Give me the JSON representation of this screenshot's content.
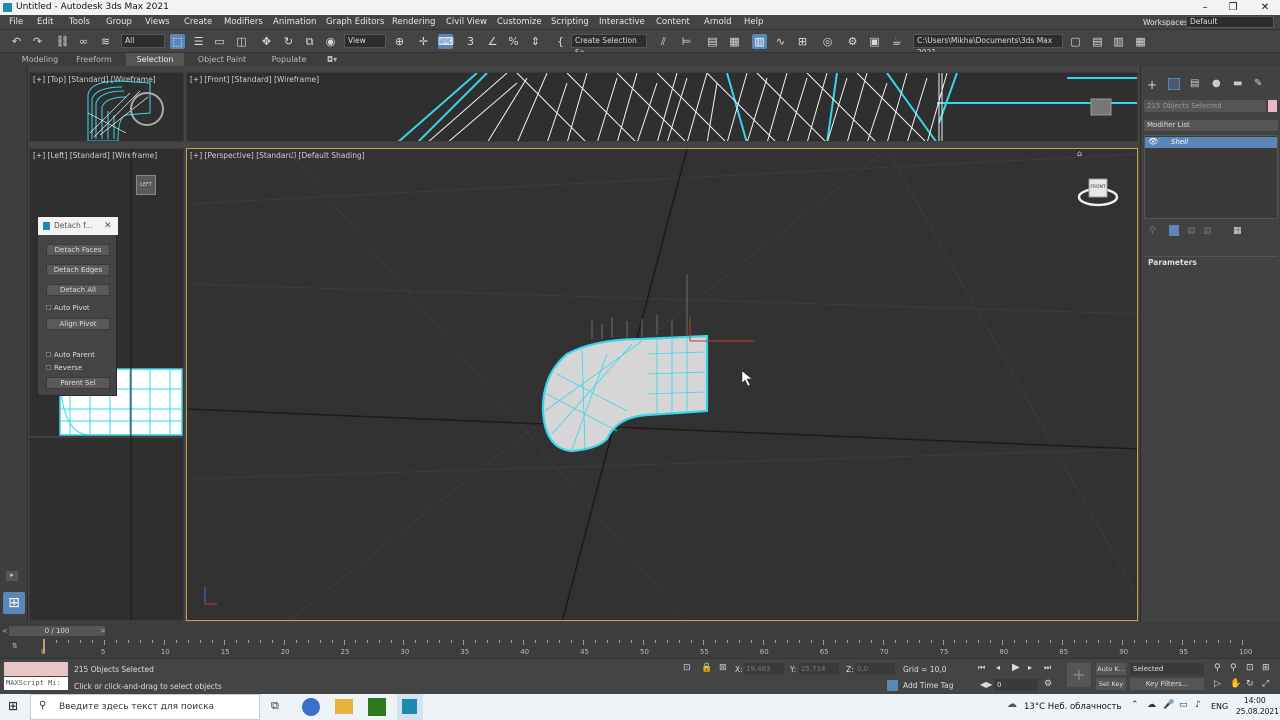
{
  "window": {
    "title": "Untitled - Autodesk 3ds Max 2021",
    "controls": [
      "–",
      "❐",
      "✕"
    ]
  },
  "menu": [
    "File",
    "Edit",
    "Tools",
    "Group",
    "Views",
    "Create",
    "Modifiers",
    "Animation",
    "Graph Editors",
    "Rendering",
    "Civil View",
    "Customize",
    "Scripting",
    "Interactive",
    "Content",
    "Arnold",
    "Help"
  ],
  "workspaces": {
    "label": "Workspaces:",
    "value": "Default"
  },
  "toolbar": {
    "filter": "All",
    "view": "View",
    "selection_set": "Create Selection Se",
    "project_path": "C:\\Users\\Mikha\\Documents\\3ds Max 2021"
  },
  "ribbon_tabs": [
    "Modeling",
    "Freeform",
    "Selection",
    "Object Paint",
    "Populate"
  ],
  "ribbon_active": "Selection",
  "viewports": {
    "top": "[+] [Top] [Standard] [Wireframe]",
    "front": "[+] [Front] [Standard] [Wireframe]",
    "left": "[+] [Left] [Standard] [Wireframe]",
    "perspective": "[+] [Perspective] [Standard] [Default Shading]",
    "viewcube_left": "LEFT",
    "viewcube_front": "FRONT"
  },
  "detach_panel": {
    "title": "Detach f...",
    "detach_faces": "Detach Faces",
    "detach_edges": "Detach Edges",
    "detach_all": "Detach All",
    "auto_pivot": "Auto Pivot",
    "align_pivot": "Align Pivot",
    "auto_parent": "Auto Parent",
    "reverse": "Reverse",
    "parent_sel": "Parent Sel"
  },
  "command_panel": {
    "selection_count": "215 Objects Selected",
    "modifier_list": "Modifier List",
    "stack_item": "Shell",
    "parameters": "Parameters"
  },
  "timeline": {
    "frame": "0 / 100",
    "ticks": [
      "0",
      "5",
      "10",
      "15",
      "20",
      "25",
      "30",
      "35",
      "40",
      "45",
      "50",
      "55",
      "60",
      "65",
      "70",
      "75",
      "80",
      "85",
      "90",
      "95",
      "100"
    ]
  },
  "status": {
    "maxscript": "MAXScript Mi:",
    "selected": "215 Objects Selected",
    "prompt": "Click or click-and-drag to select objects",
    "x_label": "X:",
    "x_value": "19,463",
    "y_label": "Y:",
    "y_value": "25,714",
    "z_label": "Z:",
    "z_value": "0,0",
    "grid": "Grid = 10,0",
    "add_time_tag": "Add Time Tag",
    "auto_key": "Auto K...",
    "set_key": "Set Key",
    "key_mode": "Selected",
    "key_filters": "Key Filters...",
    "frame_field": "0"
  },
  "taskbar": {
    "search": "Введите здесь текст для поиска",
    "weather": "13°C  Неб. облачность",
    "lang": "ENG",
    "time": "14:00",
    "date": "25.08.2021"
  },
  "colors": {
    "accent": "#5a87b8",
    "wire": "#37d5e8",
    "viewport_border": "#c2a54a"
  }
}
